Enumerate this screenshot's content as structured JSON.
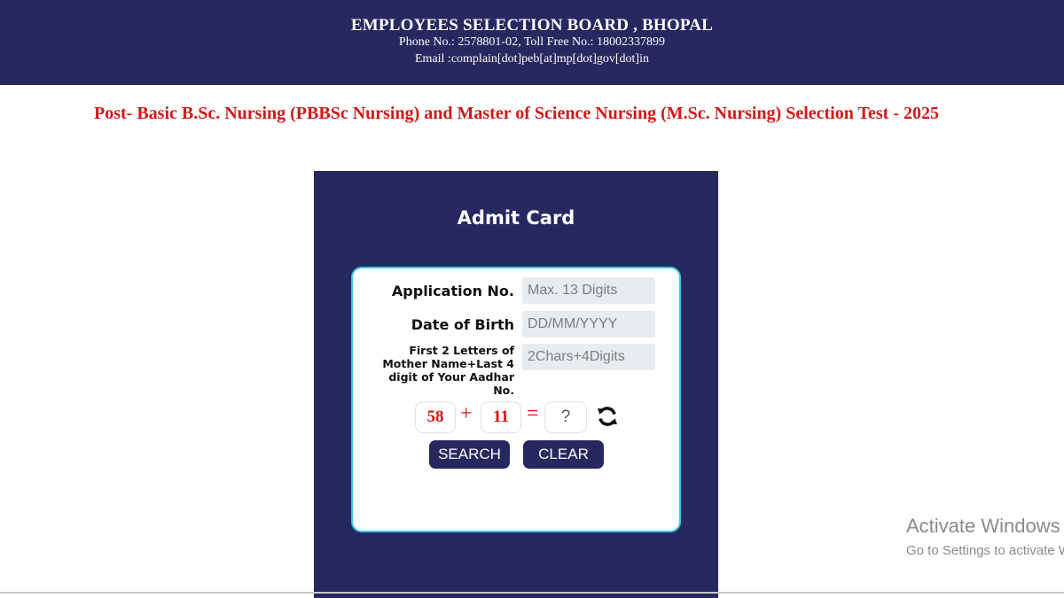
{
  "header": {
    "org": "EMPLOYEES SELECTION BOARD , BHOPAL",
    "phone": "Phone No.: 2578801-02, Toll Free No.: 18002337899",
    "email": "Email :complain[dot]peb[at]mp[dot]gov[dot]in"
  },
  "exam_title": "Post- Basic B.Sc. Nursing (PBBSc Nursing) and Master of Science Nursing (M.Sc. Nursing) Selection Test - 2025",
  "panel": {
    "title": "Admit Card"
  },
  "form": {
    "application_label": "Application No.",
    "application_placeholder": "Max. 13 Digits",
    "dob_label": "Date of Birth",
    "dob_placeholder": "DD/MM/YYYY",
    "mother_label": "First 2 Letters of Mother Name+Last 4 digit of Your Aadhar No.",
    "mother_placeholder": "2Chars+4Digits"
  },
  "captcha": {
    "num1": "58",
    "op": "+",
    "num2": "11",
    "equals": "=",
    "answer_placeholder": "?"
  },
  "buttons": {
    "search": "SEARCH",
    "clear": "CLEAR"
  },
  "watermark": {
    "line1": "Activate Windows",
    "line2": "Go to Settings to activate Windows."
  },
  "colors": {
    "navy": "#272860",
    "title_red": "#d31717",
    "card_border": "#39c6e6"
  }
}
